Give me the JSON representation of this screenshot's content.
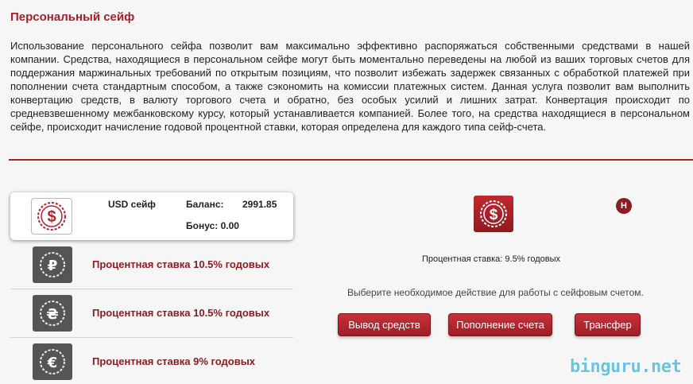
{
  "page": {
    "title": "Персональный сейф",
    "intro": "Использование персонального сейфа позволит вам максимально эффективно распоряжаться собственными средствами в нашей компании. Средства, находящиеся в персональном сейфе могут быть моментально переведены на любой из ваших торговых счетов для поддержания маржинальных требований по открытым позициям, что позволит избежать задержек связанных с обработкой платежей при пополнении счета стандартным способом, а также сэкономить на комиссии платежных систем. Данная услуга позволит вам выполнить конвертацию средств, в валюту торгового счета и обратно, без особых усилий и лишних затрат. Конвертация происходит по средневзвешенному межбанковскому курсу, который устанавливается компанией. Более того, на средства находящиеся в персональном сейфе, происходит начисление годовой процентной ставки, которая определена для каждого типа сейф-счета."
  },
  "active_safe": {
    "name": "USD сейф",
    "balance_label": "Баланс:",
    "balance_value": "2991.85",
    "bonus": "Бонус: 0.00",
    "icon": "dollar-safe-icon"
  },
  "safes": [
    {
      "icon": "ruble-safe-icon",
      "symbol": "₽",
      "rate": "Процентная ставка 10.5% годовых"
    },
    {
      "icon": "hryvnia-safe-icon",
      "symbol": "₴",
      "rate": "Процентная ставка 10.5% годовых"
    },
    {
      "icon": "euro-safe-icon",
      "symbol": "€",
      "rate": "Процентная ставка 9% годовых"
    }
  ],
  "detail": {
    "help_badge": "H",
    "rate_info": "Процентная ставка: 9.5% годовых",
    "choose_action": "Выберите необходимое действие для работы с сейфовым счетом.",
    "buttons": {
      "withdraw": "Вывод средств",
      "deposit": "Пополнение счета",
      "transfer": "Трансфер"
    }
  },
  "watermark": "binguru.net",
  "colors": {
    "accent": "#a0222a",
    "button": "#b0262d",
    "icon_dark": "#555555"
  }
}
